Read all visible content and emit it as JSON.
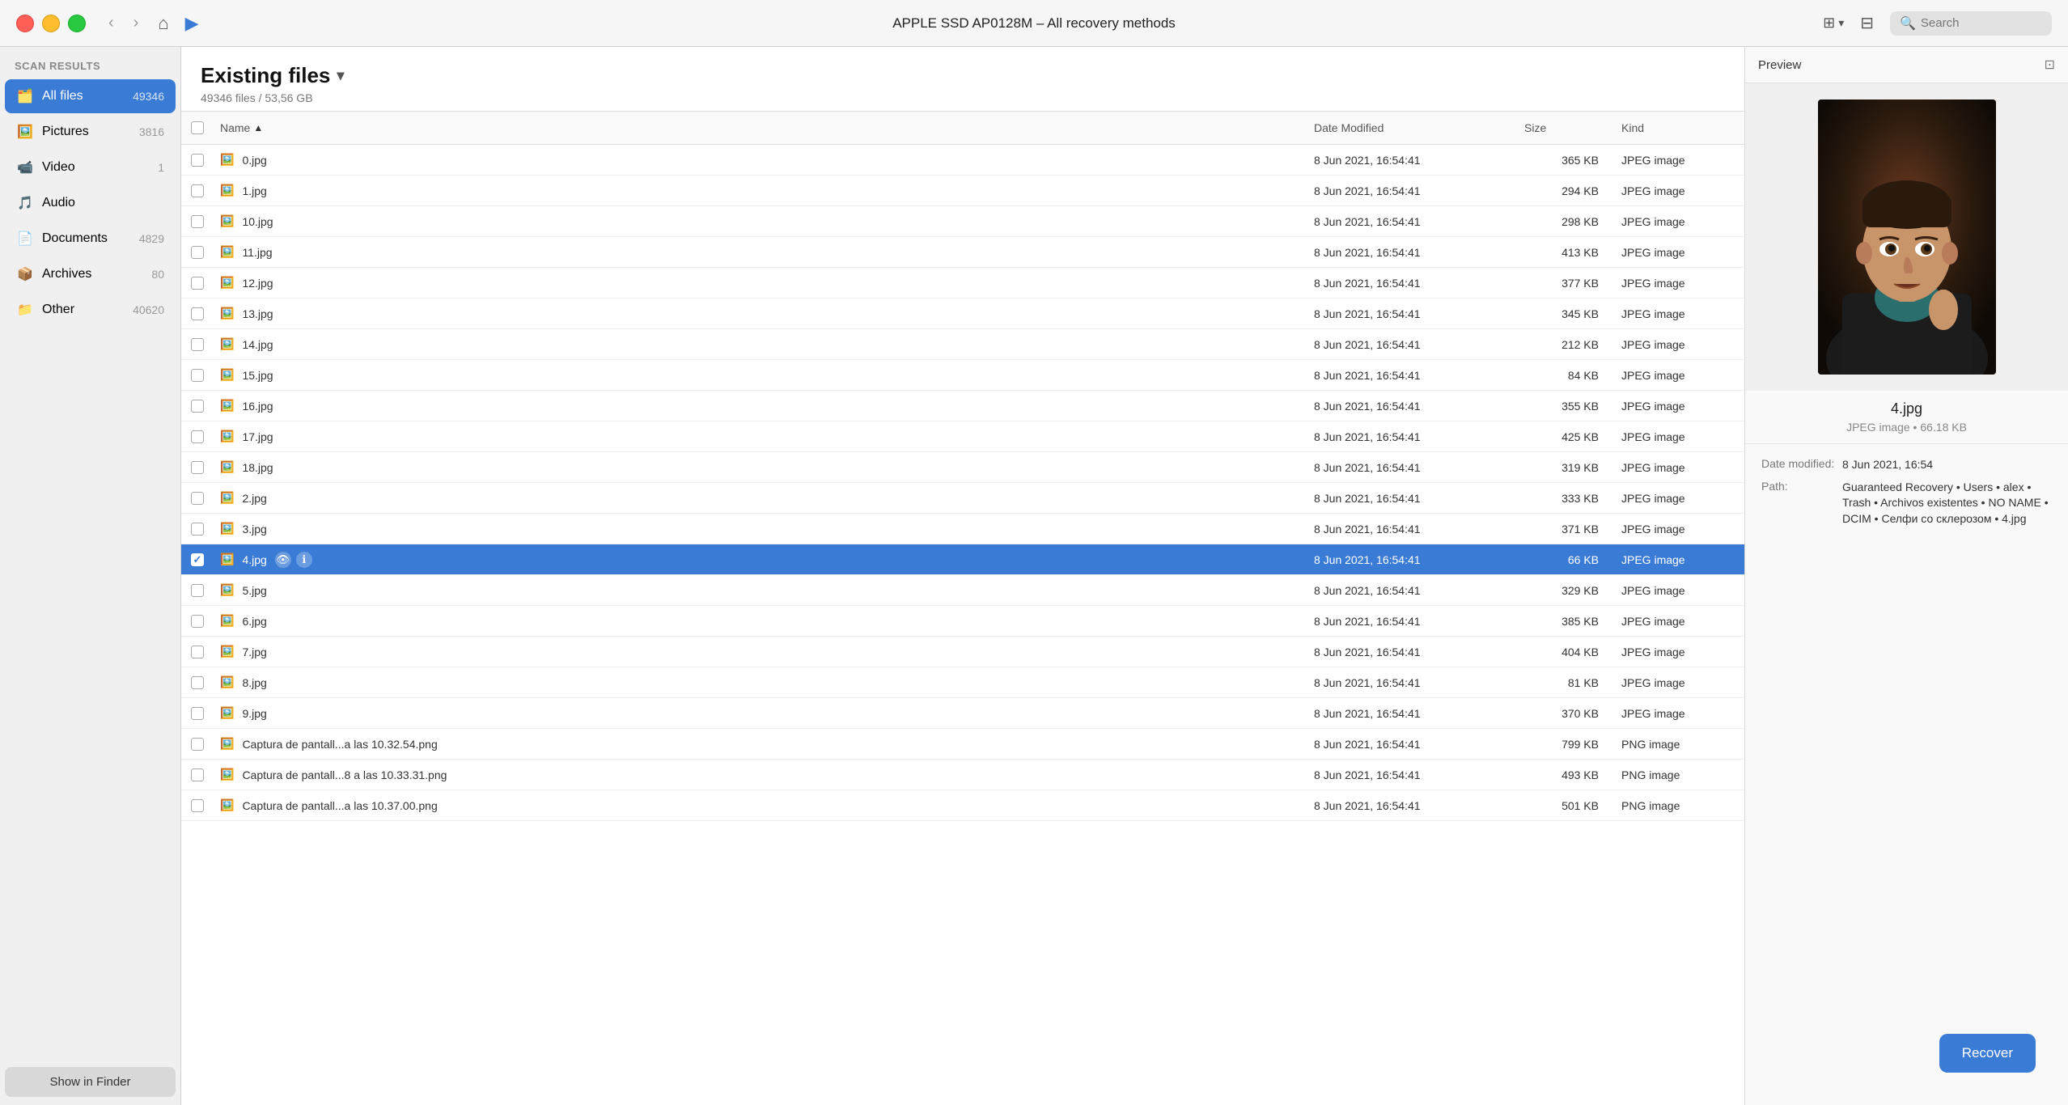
{
  "window": {
    "title": "APPLE SSD AP0128M – All recovery methods"
  },
  "titlebar": {
    "back_label": "‹",
    "forward_label": "›",
    "home_label": "⌂",
    "play_label": "▶",
    "search_placeholder": "Search",
    "view_toggle_label": "⊞",
    "filter_label": "⊟"
  },
  "sidebar": {
    "header": "Scan results",
    "items": [
      {
        "id": "all-files",
        "label": "All files",
        "count": "49346",
        "icon": "🗂️",
        "active": true
      },
      {
        "id": "pictures",
        "label": "Pictures",
        "count": "3816",
        "icon": "🖼️",
        "active": false
      },
      {
        "id": "video",
        "label": "Video",
        "count": "1",
        "icon": "📹",
        "active": false
      },
      {
        "id": "audio",
        "label": "Audio",
        "count": "",
        "icon": "🎵",
        "active": false
      },
      {
        "id": "documents",
        "label": "Documents",
        "count": "4829",
        "icon": "📄",
        "active": false
      },
      {
        "id": "archives",
        "label": "Archives",
        "count": "80",
        "icon": "📦",
        "active": false
      },
      {
        "id": "other",
        "label": "Other",
        "count": "40620",
        "icon": "📁",
        "active": false
      }
    ],
    "show_in_finder_label": "Show in Finder"
  },
  "file_panel": {
    "title": "Existing files",
    "subtitle": "49346 files / 53,56 GB",
    "columns": [
      {
        "id": "checkbox",
        "label": ""
      },
      {
        "id": "name",
        "label": "Name",
        "sorted": true,
        "sort_dir": "asc"
      },
      {
        "id": "date",
        "label": "Date Modified"
      },
      {
        "id": "size",
        "label": "Size"
      },
      {
        "id": "kind",
        "label": "Kind"
      }
    ],
    "rows": [
      {
        "name": "0.jpg",
        "date": "8 Jun 2021, 16:54:41",
        "size": "365 KB",
        "kind": "JPEG image",
        "selected": false
      },
      {
        "name": "1.jpg",
        "date": "8 Jun 2021, 16:54:41",
        "size": "294 KB",
        "kind": "JPEG image",
        "selected": false
      },
      {
        "name": "10.jpg",
        "date": "8 Jun 2021, 16:54:41",
        "size": "298 KB",
        "kind": "JPEG image",
        "selected": false
      },
      {
        "name": "11.jpg",
        "date": "8 Jun 2021, 16:54:41",
        "size": "413 KB",
        "kind": "JPEG image",
        "selected": false
      },
      {
        "name": "12.jpg",
        "date": "8 Jun 2021, 16:54:41",
        "size": "377 KB",
        "kind": "JPEG image",
        "selected": false
      },
      {
        "name": "13.jpg",
        "date": "8 Jun 2021, 16:54:41",
        "size": "345 KB",
        "kind": "JPEG image",
        "selected": false
      },
      {
        "name": "14.jpg",
        "date": "8 Jun 2021, 16:54:41",
        "size": "212 KB",
        "kind": "JPEG image",
        "selected": false
      },
      {
        "name": "15.jpg",
        "date": "8 Jun 2021, 16:54:41",
        "size": "84 KB",
        "kind": "JPEG image",
        "selected": false
      },
      {
        "name": "16.jpg",
        "date": "8 Jun 2021, 16:54:41",
        "size": "355 KB",
        "kind": "JPEG image",
        "selected": false
      },
      {
        "name": "17.jpg",
        "date": "8 Jun 2021, 16:54:41",
        "size": "425 KB",
        "kind": "JPEG image",
        "selected": false
      },
      {
        "name": "18.jpg",
        "date": "8 Jun 2021, 16:54:41",
        "size": "319 KB",
        "kind": "JPEG image",
        "selected": false
      },
      {
        "name": "2.jpg",
        "date": "8 Jun 2021, 16:54:41",
        "size": "333 KB",
        "kind": "JPEG image",
        "selected": false
      },
      {
        "name": "3.jpg",
        "date": "8 Jun 2021, 16:54:41",
        "size": "371 KB",
        "kind": "JPEG image",
        "selected": false
      },
      {
        "name": "4.jpg",
        "date": "8 Jun 2021, 16:54:41",
        "size": "66 KB",
        "kind": "JPEG image",
        "selected": true
      },
      {
        "name": "5.jpg",
        "date": "8 Jun 2021, 16:54:41",
        "size": "329 KB",
        "kind": "JPEG image",
        "selected": false
      },
      {
        "name": "6.jpg",
        "date": "8 Jun 2021, 16:54:41",
        "size": "385 KB",
        "kind": "JPEG image",
        "selected": false
      },
      {
        "name": "7.jpg",
        "date": "8 Jun 2021, 16:54:41",
        "size": "404 KB",
        "kind": "JPEG image",
        "selected": false
      },
      {
        "name": "8.jpg",
        "date": "8 Jun 2021, 16:54:41",
        "size": "81 KB",
        "kind": "JPEG image",
        "selected": false
      },
      {
        "name": "9.jpg",
        "date": "8 Jun 2021, 16:54:41",
        "size": "370 KB",
        "kind": "JPEG image",
        "selected": false
      },
      {
        "name": "Captura de pantall...a las 10.32.54.png",
        "date": "8 Jun 2021, 16:54:41",
        "size": "799 KB",
        "kind": "PNG image",
        "selected": false
      },
      {
        "name": "Captura de pantall...8 a las 10.33.31.png",
        "date": "8 Jun 2021, 16:54:41",
        "size": "493 KB",
        "kind": "PNG image",
        "selected": false
      },
      {
        "name": "Captura de pantall...a las 10.37.00.png",
        "date": "8 Jun 2021, 16:54:41",
        "size": "501 KB",
        "kind": "PNG image",
        "selected": false
      }
    ]
  },
  "preview": {
    "header_label": "Preview",
    "filename": "4.jpg",
    "meta": "JPEG image • 66.18 KB",
    "date_label": "Date modified:",
    "date_value": "8 Jun 2021, 16:54",
    "path_label": "Path:",
    "path_value": "Guaranteed Recovery • Users • alex • Trash • Archivos existentes • NO NAME • DCIM • Селфи со склерозом • 4.jpg",
    "recover_label": "Recover"
  },
  "colors": {
    "accent": "#3a7bd5",
    "selected_row": "#3a7bd5",
    "sidebar_active": "#3a7bd5"
  }
}
